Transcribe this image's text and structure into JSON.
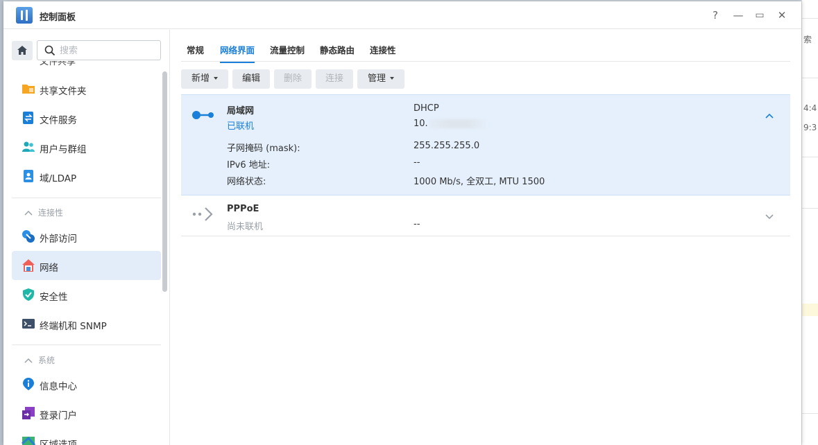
{
  "window": {
    "title": "控制面板"
  },
  "window_controls": {
    "help": "?",
    "minimize": "—",
    "maximize": "▭",
    "close": "✕"
  },
  "search": {
    "placeholder": "搜索"
  },
  "sidebar": {
    "cut_item": "文件共享",
    "items": [
      {
        "label": "共享文件夹"
      },
      {
        "label": "文件服务"
      },
      {
        "label": "用户与群组"
      },
      {
        "label": "域/LDAP"
      }
    ],
    "sections": [
      {
        "title": "连接性",
        "items": [
          {
            "label": "外部访问"
          },
          {
            "label": "网络"
          },
          {
            "label": "安全性"
          },
          {
            "label": "终端机和 SNMP"
          }
        ]
      },
      {
        "title": "系统",
        "items": [
          {
            "label": "信息中心"
          },
          {
            "label": "登录门户"
          },
          {
            "label": "区域选项"
          }
        ]
      }
    ]
  },
  "tabs": [
    {
      "label": "常规"
    },
    {
      "label": "网络界面"
    },
    {
      "label": "流量控制"
    },
    {
      "label": "静态路由"
    },
    {
      "label": "连接性"
    }
  ],
  "toolbar": {
    "create": "新增",
    "edit": "编辑",
    "delete": "删除",
    "connect": "连接",
    "manage": "管理"
  },
  "interfaces": [
    {
      "name": "局域网",
      "status": "已联机",
      "mode": "DHCP",
      "ip_prefix": "10.",
      "details": [
        {
          "key": "子网掩码 (mask):",
          "value": "255.255.255.0"
        },
        {
          "key": "IPv6 地址:",
          "value": "--"
        },
        {
          "key": "网络状态:",
          "value": "1000 Mb/s, 全双工, MTU 1500"
        }
      ]
    },
    {
      "name": "PPPoE",
      "status": "尚未联机",
      "value": "--"
    }
  ],
  "colors": {
    "accent": "#1a7fd8",
    "selected_row": "#e5f0fc",
    "connected": "#1a7fd8",
    "disconnected": "#9aa0a8"
  },
  "background": {
    "fragments": [
      "索",
      "4:4",
      "9:3"
    ]
  }
}
